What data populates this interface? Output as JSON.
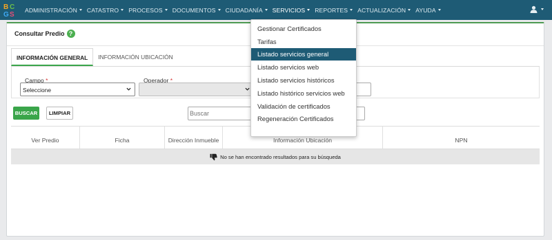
{
  "navbar": {
    "items": [
      {
        "label": "ADMINISTRACIÓN"
      },
      {
        "label": "CATASTRO"
      },
      {
        "label": "PROCESOS"
      },
      {
        "label": "DOCUMENTOS"
      },
      {
        "label": "CIUDADANÍA"
      },
      {
        "label": "SERVICIOS"
      },
      {
        "label": "REPORTES"
      },
      {
        "label": "ACTUALIZACIÓN"
      },
      {
        "label": "AYUDA"
      }
    ],
    "logo_letters": [
      "B",
      "C",
      "G",
      "S"
    ]
  },
  "panel": {
    "title": "Consultar Predio",
    "help_icon": "?"
  },
  "tabs": [
    {
      "label": "INFORMACIÓN GENERAL",
      "active": true
    },
    {
      "label": "INFORMACIÓN UBICACIÓN",
      "active": false
    }
  ],
  "filters": {
    "campo_label": "Campo",
    "campo_value": "Seleccione",
    "operador_label": "Operador",
    "required_mark": "*"
  },
  "search": {
    "placeholder": "Buscar"
  },
  "buttons": {
    "buscar": "BUSCAR",
    "limpiar": "LIMPIAR"
  },
  "table": {
    "headers": [
      "Ver Predio",
      "Ficha",
      "Dirección Inmueble",
      "Información Ubicación",
      "NPN"
    ],
    "empty_message": "No se han encontrado resultados para su búsqueda"
  },
  "dropdown": {
    "items": [
      {
        "label": "Gestionar Certificados"
      },
      {
        "label": "Tarifas"
      },
      {
        "label": "Listado servicios general"
      },
      {
        "label": "Listado servicios web"
      },
      {
        "label": "Listado servicios históricos"
      },
      {
        "label": "Listado histórico servicios web"
      },
      {
        "label": "Validación de certificados"
      },
      {
        "label": "Regeneración Certificados"
      }
    ],
    "highlighted_index": 2
  },
  "colors": {
    "navbar": "#1e5b75",
    "accent_green": "#3aa54a",
    "highlight": "#1e5b75",
    "required": "#d32f2f"
  }
}
